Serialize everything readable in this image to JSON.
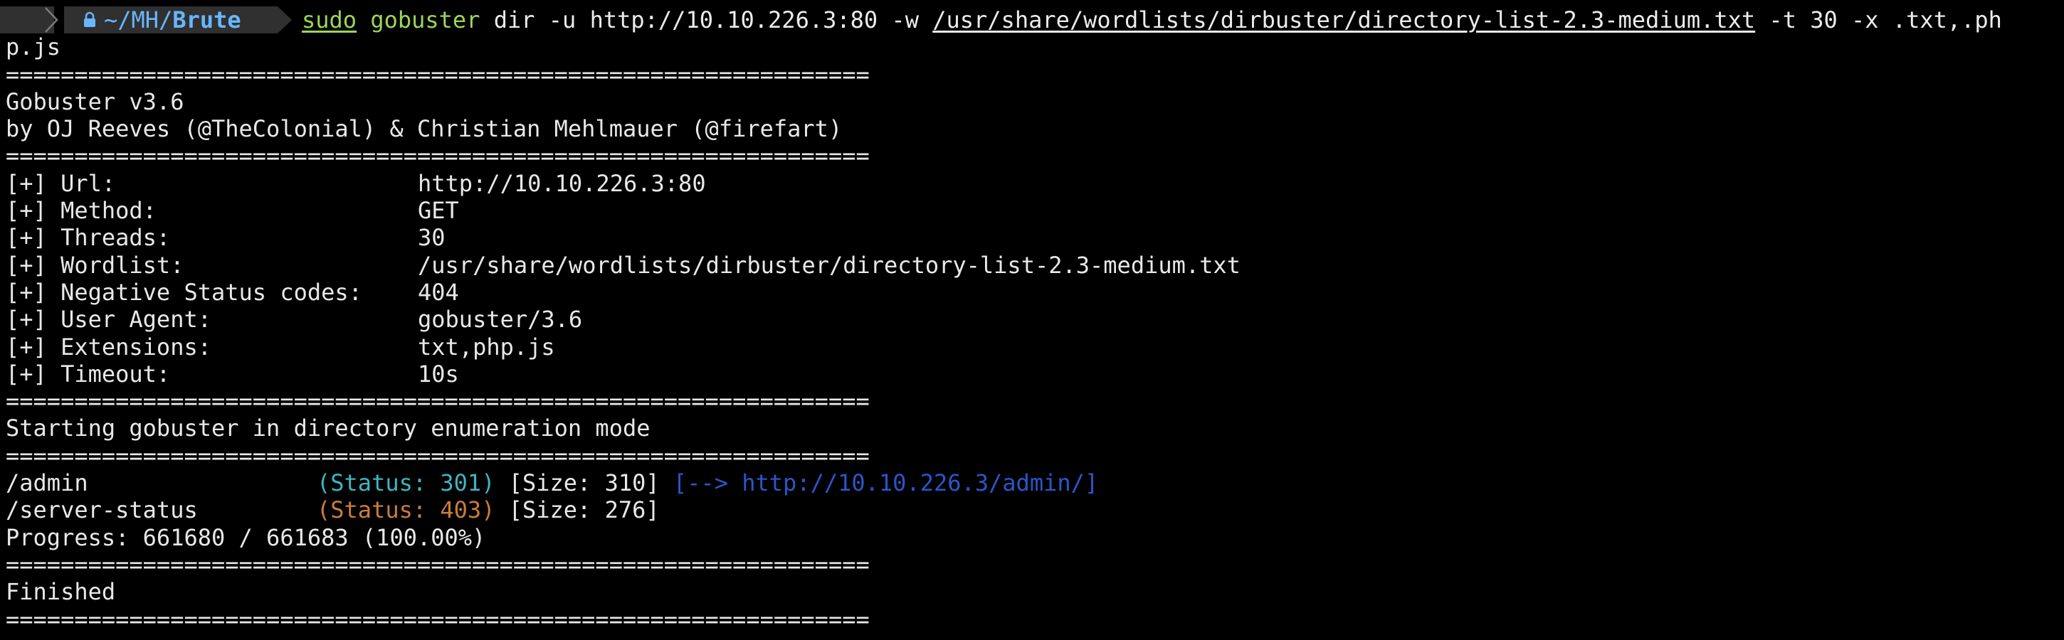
{
  "prompt": {
    "os_icon": "linux-penguin-icon",
    "lock_icon": "lock-icon",
    "dir_prefix": "~/MH/",
    "dir_current": "Brute",
    "cmd_sudo": "sudo",
    "cmd_name": "gobuster",
    "cmd_args1": " dir -u http://10.10.226.3:80 -w ",
    "cmd_wordlist": "/usr/share/wordlists/dirbuster/directory-list-2.3-medium.txt",
    "cmd_args2": " -t 30 -x .txt,.ph",
    "cmd_wrap": "p.js"
  },
  "rule": "===============================================================",
  "banner": {
    "version": "Gobuster v3.6",
    "authors": "by OJ Reeves (@TheColonial) & Christian Mehlmauer (@firefart)"
  },
  "config": [
    {
      "key": "[+] Url:",
      "value": "http://10.10.226.3:80"
    },
    {
      "key": "[+] Method:",
      "value": "GET"
    },
    {
      "key": "[+] Threads:",
      "value": "30"
    },
    {
      "key": "[+] Wordlist:",
      "value": "/usr/share/wordlists/dirbuster/directory-list-2.3-medium.txt"
    },
    {
      "key": "[+] Negative Status codes:",
      "value": "404"
    },
    {
      "key": "[+] User Agent:",
      "value": "gobuster/3.6"
    },
    {
      "key": "[+] Extensions:",
      "value": "txt,php.js"
    },
    {
      "key": "[+] Timeout:",
      "value": "10s"
    }
  ],
  "mode_line": "Starting gobuster in directory enumeration mode",
  "results": [
    {
      "path": "/admin",
      "status": "(Status: 301)",
      "size": "[Size: 310]",
      "redirect": "[--> http://10.10.226.3/admin/]"
    },
    {
      "path": "/server-status",
      "status": "(Status: 403)",
      "size": "[Size: 276]",
      "redirect": ""
    }
  ],
  "progress": "Progress: 661680 / 661683 (100.00%)",
  "finished": "Finished",
  "colors": {
    "background": "#000000",
    "prompt_segment": "#303030",
    "command_green": "#9bd65a",
    "dir_blue": "#68b6ff",
    "status_301": "#3fb3c4",
    "status_403": "#c97d39",
    "redirect_blue": "#2a56c9"
  }
}
